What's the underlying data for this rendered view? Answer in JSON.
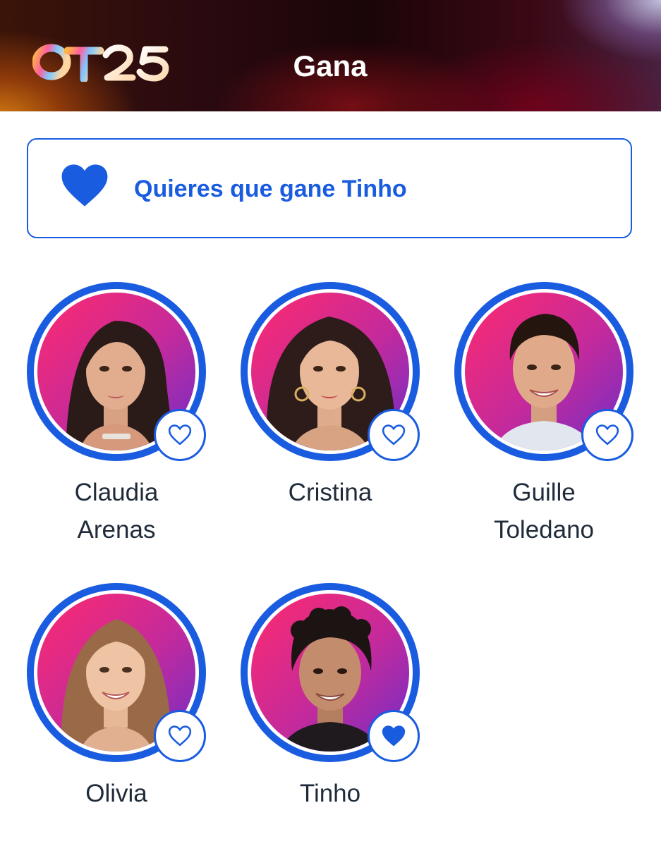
{
  "header": {
    "logo_text": "OT25",
    "title": "Gana"
  },
  "selection": {
    "message": "Quieres que gane Tinho",
    "icon": "heart-filled-icon"
  },
  "colors": {
    "accent": "#1a5ce0",
    "text": "#1f2b3a"
  },
  "contestants": [
    {
      "id": "claudia",
      "name_line1": "Claudia",
      "name_line2": "Arenas",
      "selected": false,
      "vote_icon": "heart-outline-icon"
    },
    {
      "id": "cristina",
      "name_line1": "Cristina",
      "name_line2": "",
      "selected": false,
      "vote_icon": "heart-outline-icon"
    },
    {
      "id": "guille",
      "name_line1": "Guille",
      "name_line2": "Toledano",
      "selected": false,
      "vote_icon": "heart-outline-icon"
    },
    {
      "id": "olivia",
      "name_line1": "Olivia",
      "name_line2": "",
      "selected": false,
      "vote_icon": "heart-outline-icon"
    },
    {
      "id": "tinho",
      "name_line1": "Tinho",
      "name_line2": "",
      "selected": true,
      "vote_icon": "heart-filled-icon"
    }
  ]
}
